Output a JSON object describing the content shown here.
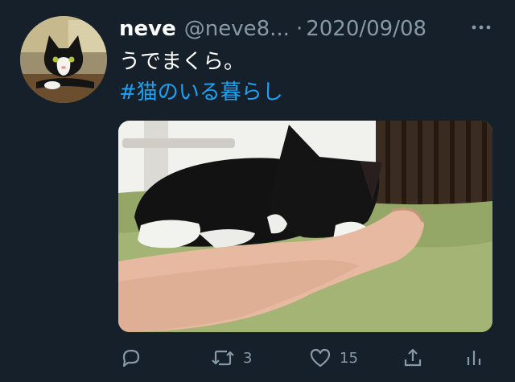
{
  "tweet": {
    "author": {
      "display_name": "neve",
      "handle": "@neve8..."
    },
    "separator": "·",
    "date": "2020/09/08",
    "text": "うでまくら。",
    "hashtag": "#猫のいる暮らし",
    "media_description": "black and white kitten sleeping on an arm",
    "actions": {
      "reply": {
        "icon": "reply-icon"
      },
      "retweet": {
        "icon": "retweet-icon",
        "count": "3"
      },
      "like": {
        "icon": "heart-icon",
        "count": "15"
      },
      "share": {
        "icon": "share-icon"
      },
      "analytics": {
        "icon": "analytics-icon"
      }
    }
  },
  "colors": {
    "background": "#15202b",
    "text_primary": "#ffffff",
    "text_secondary": "#8899a6",
    "link": "#1da1f2"
  }
}
